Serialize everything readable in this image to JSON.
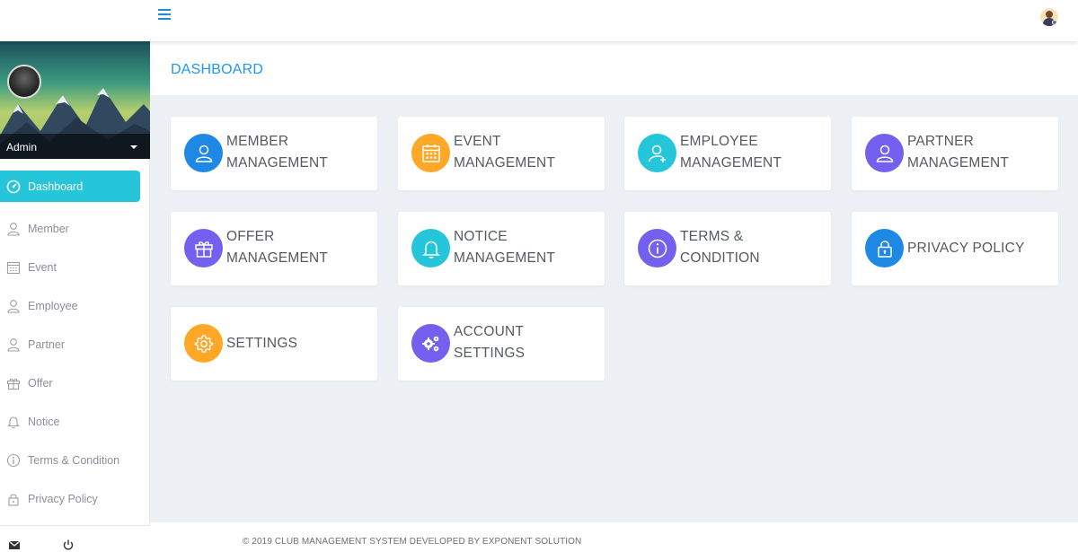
{
  "topbar": {
    "menu_icon": "hamburger-icon",
    "user_icon": "user-avatar-icon"
  },
  "sidebar": {
    "user_name": "Admin",
    "items": [
      {
        "label": "Dashboard",
        "icon": "dashboard-icon",
        "active": true
      },
      {
        "label": "Member",
        "icon": "user-icon"
      },
      {
        "label": "Event",
        "icon": "calendar-icon"
      },
      {
        "label": "Employee",
        "icon": "user-icon"
      },
      {
        "label": "Partner",
        "icon": "user-icon"
      },
      {
        "label": "Offer",
        "icon": "gift-icon"
      },
      {
        "label": "Notice",
        "icon": "bell-icon"
      },
      {
        "label": "Terms & Condition",
        "icon": "info-icon"
      },
      {
        "label": "Privacy Policy",
        "icon": "lock-icon"
      }
    ],
    "footer_icons": [
      "mail-icon",
      "power-icon"
    ]
  },
  "page": {
    "title": "DASHBOARD"
  },
  "cards": [
    {
      "line1": "MEMBER",
      "line2": "MANAGEMENT",
      "icon": "user-icon",
      "color": "#1e88e5"
    },
    {
      "line1": "EVENT",
      "line2": "MANAGEMENT",
      "icon": "calendar-icon",
      "color": "#ffa726"
    },
    {
      "line1": "EMPLOYEE",
      "line2": "MANAGEMENT",
      "icon": "user-plus-icon",
      "color": "#26c6da"
    },
    {
      "line1": "PARTNER",
      "line2": "MANAGEMENT",
      "icon": "user-icon",
      "color": "#7460ee"
    },
    {
      "line1": "OFFER",
      "line2": "MANAGEMENT",
      "icon": "gift-icon",
      "color": "#7460ee"
    },
    {
      "line1": "NOTICE",
      "line2": "MANAGEMENT",
      "icon": "bell-icon",
      "color": "#26c6da"
    },
    {
      "line1": "TERMS &",
      "line2": "CONDITION",
      "icon": "info-icon",
      "color": "#7460ee"
    },
    {
      "line1": "PRIVACY POLICY",
      "line2": "",
      "icon": "lock-icon",
      "color": "#1e88e5"
    },
    {
      "line1": "SETTINGS",
      "line2": "",
      "icon": "gear-icon",
      "color": "#ffa726"
    },
    {
      "line1": "ACCOUNT",
      "line2": "SETTINGS",
      "icon": "gears-icon",
      "color": "#7460ee"
    }
  ],
  "footer": {
    "text": "© 2019 CLUB MANAGEMENT SYSTEM DEVELOPED BY EXPONENT SOLUTION"
  }
}
